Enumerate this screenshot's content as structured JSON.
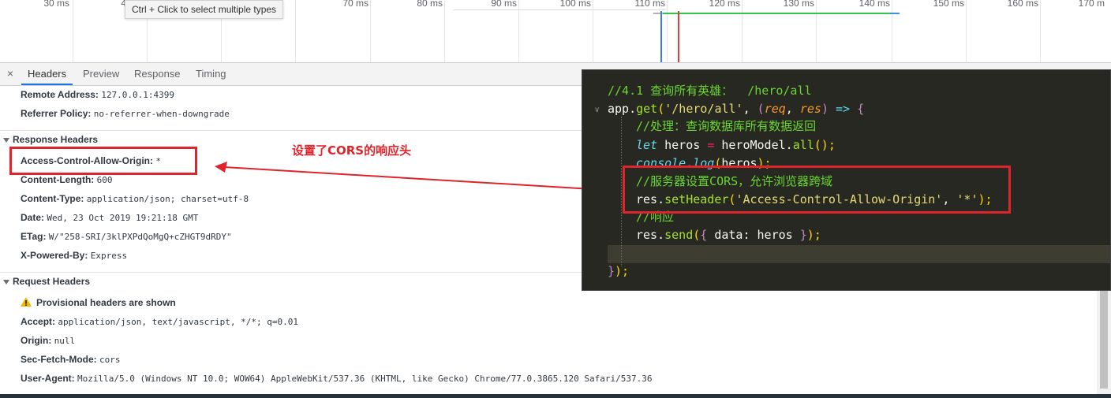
{
  "timeline": {
    "ticks": [
      "30 ms",
      "4",
      "70 ms",
      "80 ms",
      "90 ms",
      "100 ms",
      "110 ms",
      "120 ms",
      "130 ms",
      "140 ms",
      "150 ms",
      "160 ms",
      "170 m"
    ],
    "tooltip": "Ctrl + Click to select multiple types"
  },
  "tabs": {
    "close": "×",
    "items": [
      "Headers",
      "Preview",
      "Response",
      "Timing"
    ]
  },
  "general": [
    {
      "key": "Remote Address:",
      "value": "127.0.0.1:4399"
    },
    {
      "key": "Referrer Policy:",
      "value": "no-referrer-when-downgrade"
    }
  ],
  "response_headers": {
    "title": "Response Headers",
    "items": [
      {
        "key": "Access-Control-Allow-Origin:",
        "value": "*"
      },
      {
        "key": "Content-Length:",
        "value": "600"
      },
      {
        "key": "Content-Type:",
        "value": "application/json; charset=utf-8"
      },
      {
        "key": "Date:",
        "value": "Wed, 23 Oct 2019 19:21:18 GMT"
      },
      {
        "key": "ETag:",
        "value": "W/\"258-SRI/3klPXPdQoMgQ+cZHGT9dRDY\""
      },
      {
        "key": "X-Powered-By:",
        "value": "Express"
      }
    ]
  },
  "request_headers": {
    "title": "Request Headers",
    "warning": "Provisional headers are shown",
    "items": [
      {
        "key": "Accept:",
        "value": "application/json, text/javascript, */*; q=0.01"
      },
      {
        "key": "Origin:",
        "value": "null"
      },
      {
        "key": "Sec-Fetch-Mode:",
        "value": "cors"
      },
      {
        "key": "User-Agent:",
        "value": "Mozilla/5.0 (Windows NT 10.0; WOW64) AppleWebKit/537.36 (KHTML, like Gecko) Chrome/77.0.3865.120 Safari/537.36"
      }
    ]
  },
  "annotation": {
    "text": "设置了CORS的响应头",
    "color": "#e0242b"
  },
  "code": {
    "l1_comment": "//4.1 查询所有英雄：  /hero/all",
    "l2": {
      "obj": "app",
      "dot": ".",
      "fn": "get",
      "p1": "(",
      "path": "'/hero/all'",
      "comma": ", ",
      "p2": "(",
      "req": "req",
      "c2": ", ",
      "res": "res",
      "p3": ")",
      "arrow": " => ",
      "brace": "{"
    },
    "l3_comment": "//处理：查询数据库所有数据返回",
    "l4": {
      "let": "let",
      "name": " heros ",
      "eq": "=",
      "model": " heroModel",
      "dot": ".",
      "fn": "all",
      "call": "();"
    },
    "l5": {
      "console": "console",
      "dot": ".",
      "fn": "log",
      "p": "(",
      "arg": "heros",
      "end": ");"
    },
    "l6_comment": "//服务器设置CORS，允许浏览器跨域",
    "l7": {
      "res": "res",
      "dot": ".",
      "fn": "setHeader",
      "p": "(",
      "s1": "'Access-Control-Allow-Origin'",
      "comma": ", ",
      "s2": "'*'",
      "end": ");"
    },
    "l8_comment": "//响应",
    "l9": {
      "res": "res",
      "dot": ".",
      "fn": "send",
      "p": "(",
      "ob": "{ ",
      "key": "data",
      "colon": ": ",
      "val": "heros",
      "cb": " }",
      "end": ");"
    },
    "l11": {
      "brace": "}",
      "end": ");"
    }
  }
}
